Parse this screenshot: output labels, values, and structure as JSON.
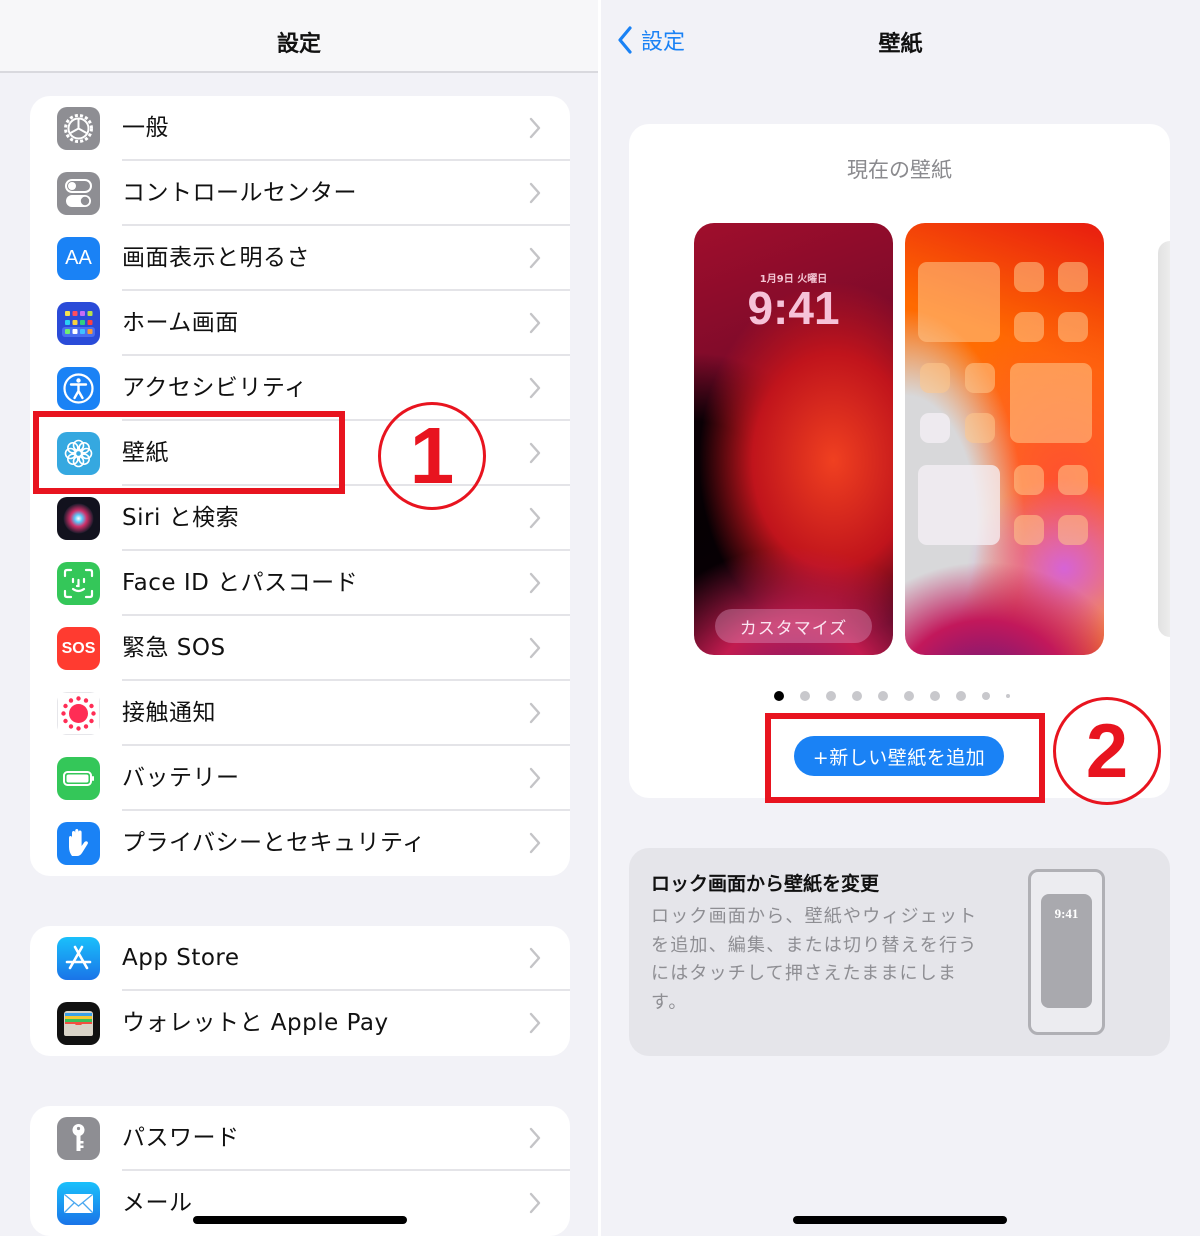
{
  "left": {
    "title": "設定",
    "groups": [
      {
        "items": [
          {
            "label": "一般",
            "icon": "gear-icon",
            "color": "#8e8e93"
          },
          {
            "label": "コントロールセンター",
            "icon": "toggles-icon",
            "color": "#8e8e93"
          },
          {
            "label": "画面表示と明るさ",
            "icon": "text-size-icon",
            "color": "#1a82f5",
            "glyph": "AA"
          },
          {
            "label": "ホーム画面",
            "icon": "home-grid-icon",
            "color": "#2a4bd8"
          },
          {
            "label": "アクセシビリティ",
            "icon": "accessibility-icon",
            "color": "#1a82f5"
          },
          {
            "label": "壁紙",
            "icon": "flower-icon",
            "color": "#35a8e0"
          },
          {
            "label": "Siri と検索",
            "icon": "siri-icon",
            "color": "#1a1a2a"
          },
          {
            "label": "Face ID とパスコード",
            "icon": "face-id-icon",
            "color": "#34c759"
          },
          {
            "label": "緊急 SOS",
            "icon": "sos-icon",
            "color": "#ff3b30",
            "glyph": "SOS"
          },
          {
            "label": "接触通知",
            "icon": "exposure-notification-icon",
            "color": "#ffffff"
          },
          {
            "label": "バッテリー",
            "icon": "battery-icon",
            "color": "#34c759"
          },
          {
            "label": "プライバシーとセキュリティ",
            "icon": "hand-icon",
            "color": "#1a82f5"
          }
        ]
      },
      {
        "items": [
          {
            "label": "App Store",
            "icon": "app-store-icon",
            "color": "#1a8cf7"
          },
          {
            "label": "ウォレットと Apple Pay",
            "icon": "wallet-icon",
            "color": "#111111"
          }
        ]
      },
      {
        "items": [
          {
            "label": "パスワード",
            "icon": "key-icon",
            "color": "#8e8e93"
          },
          {
            "label": "メール",
            "icon": "mail-icon",
            "color": "#1a8cf7"
          }
        ]
      }
    ],
    "annotation": {
      "number": "1"
    }
  },
  "right": {
    "back_label": "設定",
    "title": "壁紙",
    "current_caption": "現在の壁紙",
    "lock_preview": {
      "date": "1月9日 火曜日",
      "time": "9:41",
      "customize_label": "カスタマイズ"
    },
    "page_dots": {
      "count": 10,
      "active": 1
    },
    "add_button_label": "+新しい壁紙を追加",
    "annotation": {
      "number": "2"
    },
    "info": {
      "title": "ロック画面から壁紙を変更",
      "body": "ロック画面から、壁紙やウィジェットを追加、編集、または切り替えを行うにはタッチして押さえたままにします。",
      "mini_phone_time": "9:41"
    }
  },
  "colors": {
    "accent": "#1a82f5",
    "annotation_red": "#e8141f",
    "background": "#f2f2f7"
  }
}
